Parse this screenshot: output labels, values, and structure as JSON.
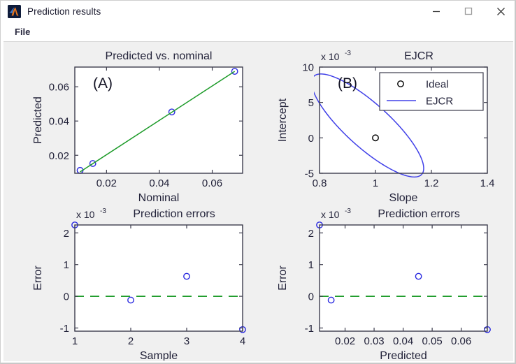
{
  "window": {
    "title": "Prediction results",
    "icon": "matlab-membrane-icon",
    "controls": {
      "minimize": "minimize-icon",
      "maximize": "maximize-icon",
      "close": "close-icon"
    }
  },
  "menubar": {
    "items": [
      {
        "label": "File"
      }
    ]
  },
  "figure": {
    "background_color": "#f0f0f0"
  },
  "chart_data": [
    {
      "id": "predicted-vs-nominal",
      "type": "scatter",
      "title": "Predicted vs. nominal",
      "panel_label": "(A)",
      "xlabel": "Nominal",
      "ylabel": "Predicted",
      "xlim": [
        0.008,
        0.0715
      ],
      "ylim": [
        0.0095,
        0.0715
      ],
      "xticks": [
        0.02,
        0.04,
        0.06
      ],
      "xticklabels": [
        "0.02",
        "0.04",
        "0.06"
      ],
      "yticks": [
        0.02,
        0.04,
        0.06
      ],
      "yticklabels": [
        "0.02",
        "0.04",
        "0.06"
      ],
      "exponent": "",
      "grid": false,
      "series": [
        {
          "name": "data",
          "style": "circle-marker",
          "color": "#2a2ae0",
          "x": [
            0.01,
            0.0148,
            0.0447,
            0.0685
          ],
          "y": [
            0.0112,
            0.0152,
            0.0453,
            0.069
          ]
        },
        {
          "name": "fit",
          "style": "solid-line",
          "color": "#1d9b29",
          "x": [
            0.01,
            0.0685
          ],
          "y": [
            0.0103,
            0.069
          ]
        }
      ]
    },
    {
      "id": "ejcr",
      "type": "line",
      "title": "EJCR",
      "panel_label": "(B)",
      "xlabel": "Slope",
      "ylabel": "Intercept",
      "xlim": [
        0.8,
        1.4
      ],
      "ylim": [
        -0.005,
        0.01
      ],
      "xticks": [
        0.8,
        1.0,
        1.2,
        1.4
      ],
      "xticklabels": [
        "0.8",
        "1",
        "1.2",
        "1.4"
      ],
      "yticks": [
        -0.005,
        0.0,
        0.005,
        0.01
      ],
      "yticklabels": [
        "-5",
        "0",
        "5",
        "10"
      ],
      "exponent": "x 10",
      "exponent_power": "-3",
      "grid": false,
      "legend": {
        "position": "top-right",
        "entries": [
          {
            "label": "Ideal",
            "style": "circle-marker",
            "color": "#000000"
          },
          {
            "label": "EJCR",
            "style": "solid-line",
            "color": "#4040e8"
          }
        ]
      },
      "series": [
        {
          "name": "Ideal",
          "style": "circle-marker",
          "color": "#000000",
          "x": [
            1.0
          ],
          "y": [
            0.0
          ]
        },
        {
          "name": "EJCR",
          "style": "ellipse",
          "color": "#4040e8",
          "ellipse": {
            "center_x": 0.972,
            "center_y": 0.00175,
            "semi_major": 0.0088,
            "semi_minor": 0.00255,
            "rotation_deg": -54
          }
        }
      ]
    },
    {
      "id": "prediction-errors-sample",
      "type": "scatter",
      "title": "Prediction errors",
      "panel_label": "",
      "xlabel": "Sample",
      "ylabel": "Error",
      "xlim": [
        1,
        4
      ],
      "ylim": [
        -0.0011,
        0.00225
      ],
      "xticks": [
        1,
        2,
        3,
        4
      ],
      "xticklabels": [
        "1",
        "2",
        "3",
        "4"
      ],
      "yticks": [
        -0.001,
        0.0,
        0.001,
        0.002
      ],
      "yticklabels": [
        "-1",
        "0",
        "1",
        "2"
      ],
      "exponent": "x 10",
      "exponent_power": "-3",
      "grid": false,
      "series": [
        {
          "name": "errors",
          "style": "circle-marker",
          "color": "#2a2ae0",
          "x": [
            1,
            2,
            3,
            4
          ],
          "y": [
            0.00225,
            -0.00012,
            0.00063,
            -0.00105
          ]
        },
        {
          "name": "zero-line",
          "style": "dashed-line",
          "color": "#1d9b29",
          "x": [
            1,
            4
          ],
          "y": [
            0,
            0
          ]
        }
      ]
    },
    {
      "id": "prediction-errors-predicted",
      "type": "scatter",
      "title": "Prediction errors",
      "panel_label": "",
      "xlabel": "Predicted",
      "ylabel": "Error",
      "xlim": [
        0.0112,
        0.069
      ],
      "ylim": [
        -0.0011,
        0.00225
      ],
      "xticks": [
        0.02,
        0.03,
        0.04,
        0.05,
        0.06
      ],
      "xticklabels": [
        "0.02",
        "0.03",
        "0.04",
        "0.05",
        "0.06"
      ],
      "yticks": [
        -0.001,
        0.0,
        0.001,
        0.002
      ],
      "yticklabels": [
        "-1",
        "0",
        "1",
        "2"
      ],
      "exponent": "x 10",
      "exponent_power": "-3",
      "grid": false,
      "series": [
        {
          "name": "errors",
          "style": "circle-marker",
          "color": "#2a2ae0",
          "x": [
            0.0112,
            0.0152,
            0.0453,
            0.069
          ],
          "y": [
            0.00225,
            -0.00012,
            0.00063,
            -0.00105
          ]
        },
        {
          "name": "zero-line",
          "style": "dashed-line",
          "color": "#1d9b29",
          "x": [
            0.0112,
            0.069
          ],
          "y": [
            0,
            0
          ]
        }
      ]
    }
  ]
}
